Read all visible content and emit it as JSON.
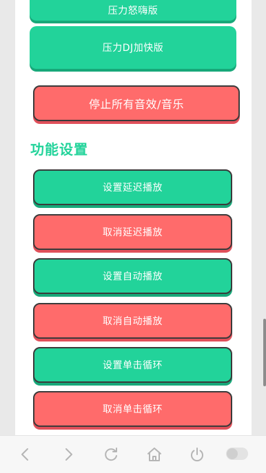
{
  "buttons": {
    "top_partial": "压力怒嗨版",
    "dj_fast": "压力DJ加快版",
    "stop_all": "停止所有音效/音乐"
  },
  "section": {
    "title": "功能设置",
    "items": [
      {
        "label": "设置延迟播放",
        "color": "#22d39a"
      },
      {
        "label": "取消延迟播放",
        "color": "#ff6b6b"
      },
      {
        "label": "设置自动播放",
        "color": "#22d39a"
      },
      {
        "label": "取消自动播放",
        "color": "#ff6b6b"
      },
      {
        "label": "设置单击循环",
        "color": "#22d39a"
      },
      {
        "label": "取消单击循环",
        "color": "#ff6b6b"
      }
    ]
  },
  "colors": {
    "accent_green": "#22d39a",
    "accent_red": "#ff6b6b",
    "background": "#ffffff"
  },
  "bottom_nav": {
    "icons": [
      "back-icon",
      "forward-icon",
      "refresh-icon",
      "home-icon",
      "power-icon",
      "toggle-switch"
    ]
  }
}
